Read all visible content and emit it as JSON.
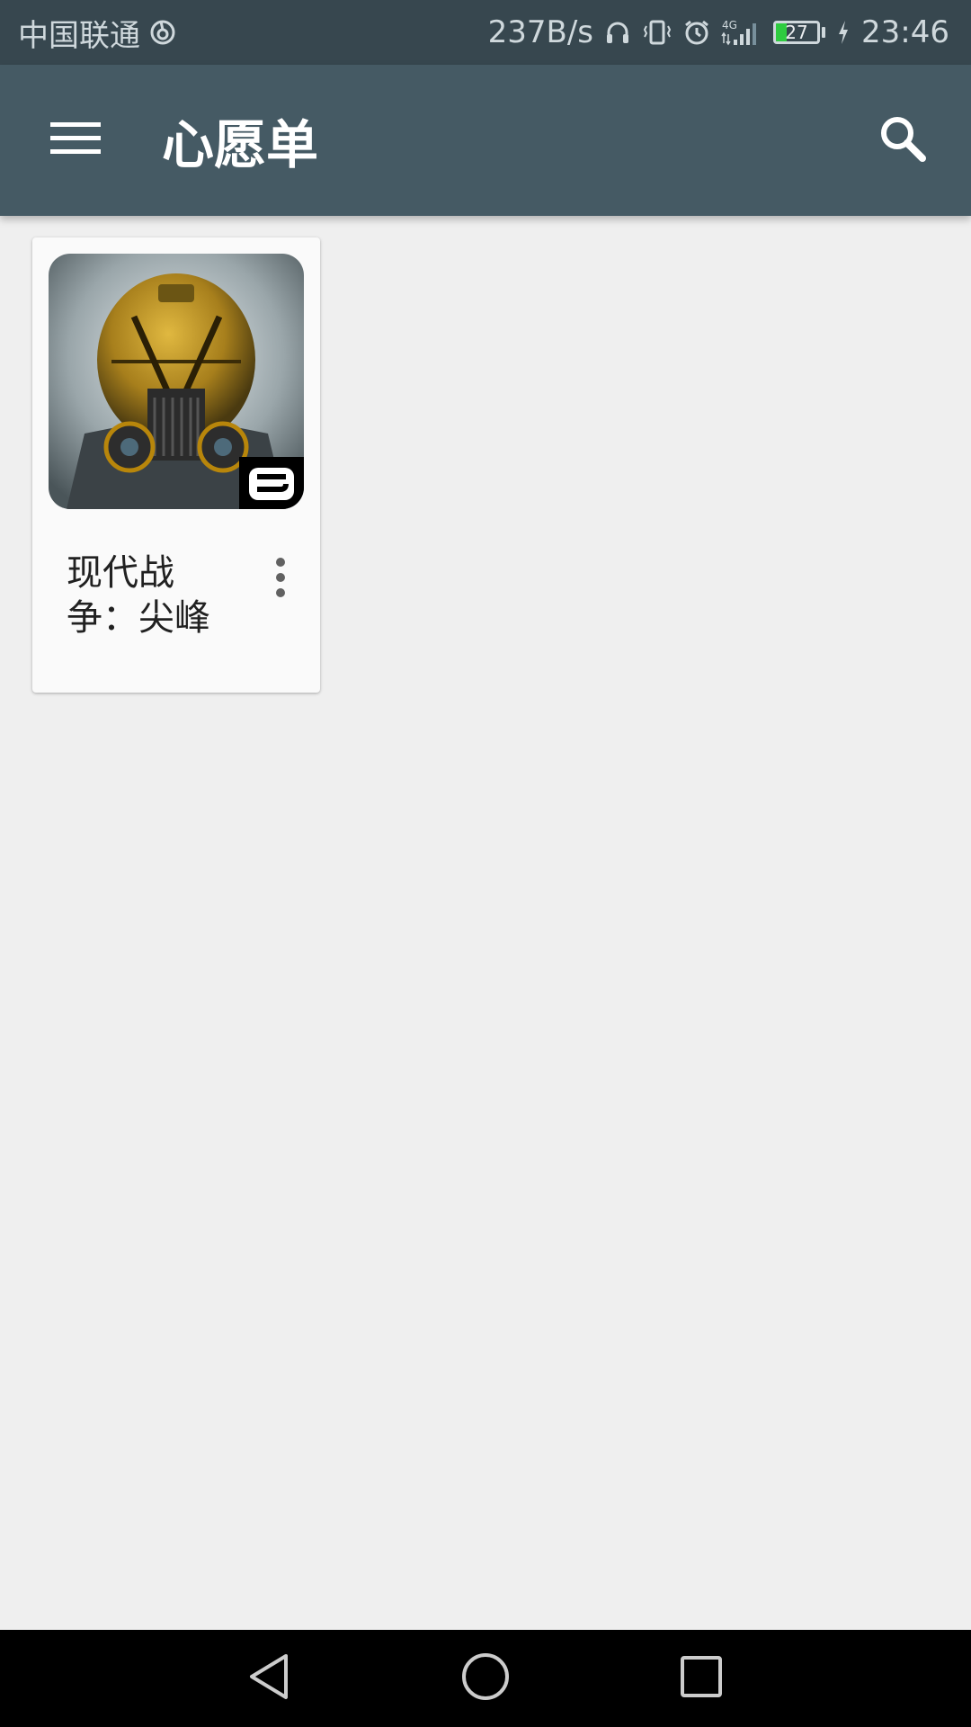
{
  "status_bar": {
    "carrier": "中国联通",
    "speed": "237B/s",
    "network": "4G",
    "battery": "27",
    "battery_level": 0.27,
    "time": "23:46"
  },
  "app_bar": {
    "title": "心愿单",
    "menu_icon": "hamburger-menu-icon",
    "search_icon": "search-icon"
  },
  "wishlist": {
    "items": [
      {
        "title": "现代战争：尖峰",
        "overflow_icon": "more-vert-icon"
      }
    ]
  },
  "colors": {
    "status_bar": "#37474f",
    "app_bar": "#455a64",
    "background": "#efefef",
    "card": "#fafafa",
    "battery_fill": "#2ecc40"
  },
  "nav_bar": {
    "back_icon": "back-triangle-icon",
    "home_icon": "home-circle-icon",
    "recents_icon": "recents-square-icon"
  }
}
